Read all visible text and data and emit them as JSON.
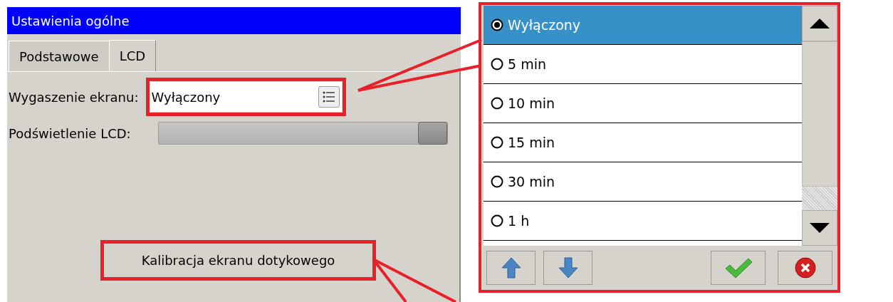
{
  "window": {
    "title": "Ustawienia ogólne"
  },
  "tabs": [
    {
      "label": "Podstawowe",
      "selected": false
    },
    {
      "label": "LCD",
      "selected": true
    }
  ],
  "screen_blanking": {
    "label": "Wygaszenie ekranu:",
    "value": "Wyłączony"
  },
  "backlight": {
    "label": "Podświetlenie LCD:",
    "level": 1
  },
  "calibrate_button": "Kalibracja ekranu dotykowego",
  "popup": {
    "options": [
      {
        "label": "Wyłączony",
        "selected": true
      },
      {
        "label": "5 min",
        "selected": false
      },
      {
        "label": "10 min",
        "selected": false
      },
      {
        "label": "15 min",
        "selected": false
      },
      {
        "label": "30 min",
        "selected": false
      },
      {
        "label": "1 h",
        "selected": false
      }
    ]
  }
}
